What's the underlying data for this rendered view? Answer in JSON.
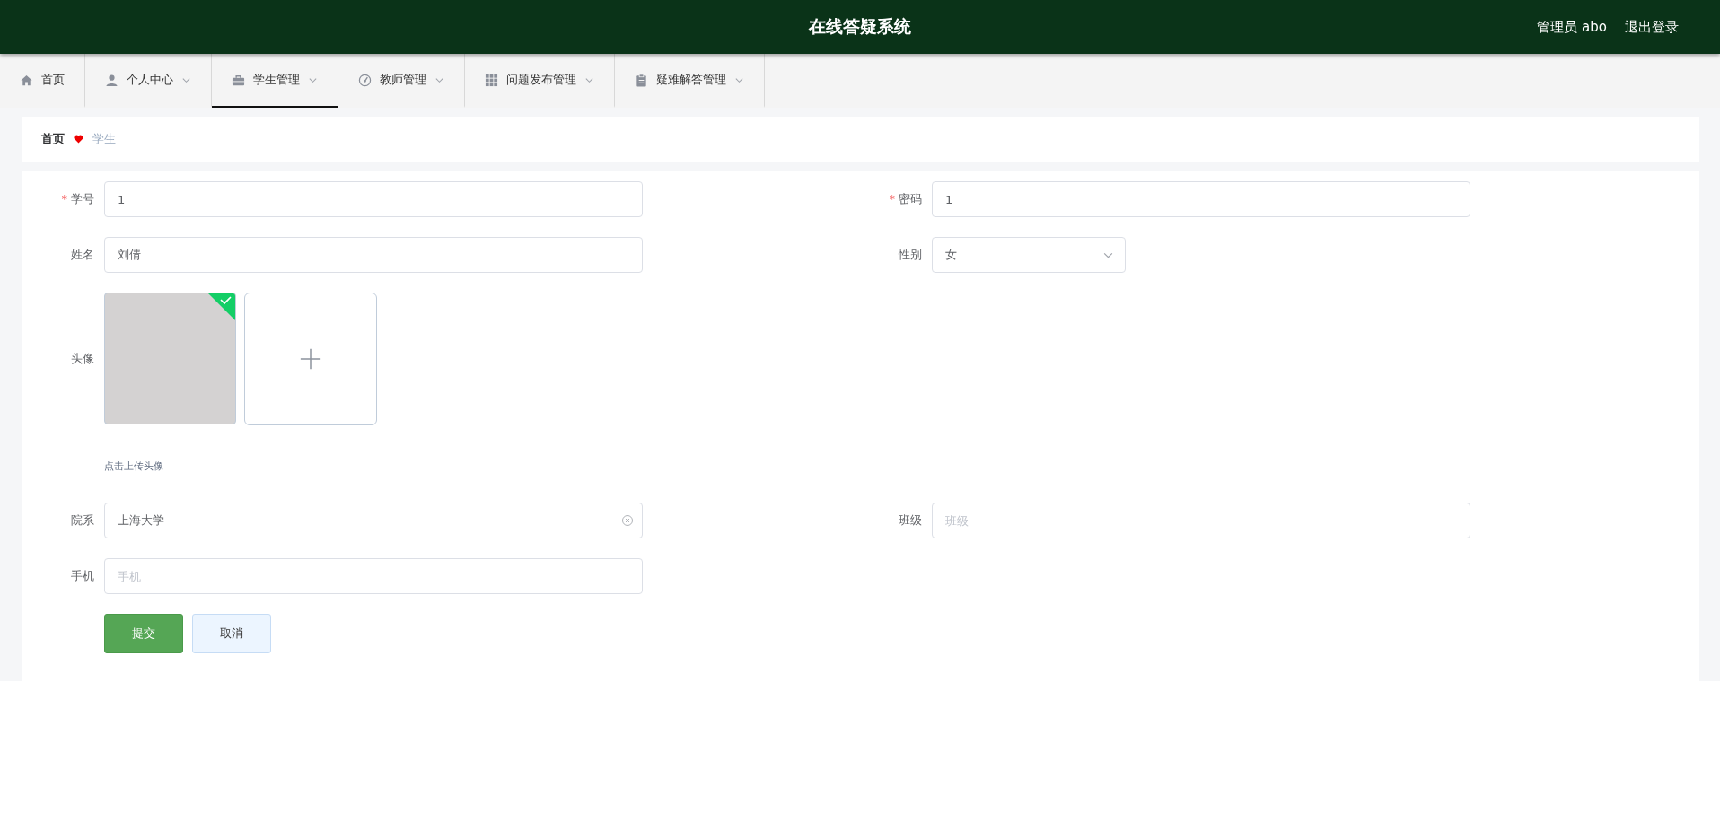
{
  "header": {
    "title": "在线答疑系统",
    "user": "管理员 abo",
    "logout": "退出登录"
  },
  "tabs": [
    {
      "label": "首页",
      "kind": "home",
      "has_menu": false,
      "selected": false
    },
    {
      "label": "个人中心",
      "kind": "user",
      "has_menu": true,
      "selected": false
    },
    {
      "label": "学生管理",
      "kind": "briefcase",
      "has_menu": true,
      "selected": true
    },
    {
      "label": "教师管理",
      "kind": "gauge",
      "has_menu": true,
      "selected": false
    },
    {
      "label": "问题发布管理",
      "kind": "grid",
      "has_menu": true,
      "selected": false
    },
    {
      "label": "疑难解答管理",
      "kind": "clipboard",
      "has_menu": true,
      "selected": false
    }
  ],
  "breadcrumb": {
    "home": "首页",
    "current": "学生"
  },
  "form": {
    "rows": [
      [
        {
          "kind": "input",
          "required_mark": "*",
          "label": "学号",
          "value": "1"
        },
        {
          "kind": "input",
          "required_mark": "*",
          "label": "密码",
          "value": "1"
        }
      ],
      [
        {
          "kind": "input",
          "label": "姓名",
          "value": "刘倩"
        },
        {
          "kind": "select",
          "label": "性别",
          "value": "女"
        }
      ],
      [
        {
          "kind": "upload",
          "label": "头像",
          "uploaded": true,
          "hint": "点击上传头像"
        }
      ],
      [
        {
          "kind": "input",
          "label": "院系",
          "value": "上海大学",
          "clearable": true
        },
        {
          "kind": "input",
          "label": "班级",
          "placeholder": "班级"
        }
      ],
      [
        {
          "kind": "input",
          "label": "手机",
          "placeholder": "手机"
        }
      ]
    ],
    "buttons": [
      {
        "label": "提交",
        "kind": "primary"
      },
      {
        "label": "取消",
        "kind": "plain"
      }
    ]
  }
}
